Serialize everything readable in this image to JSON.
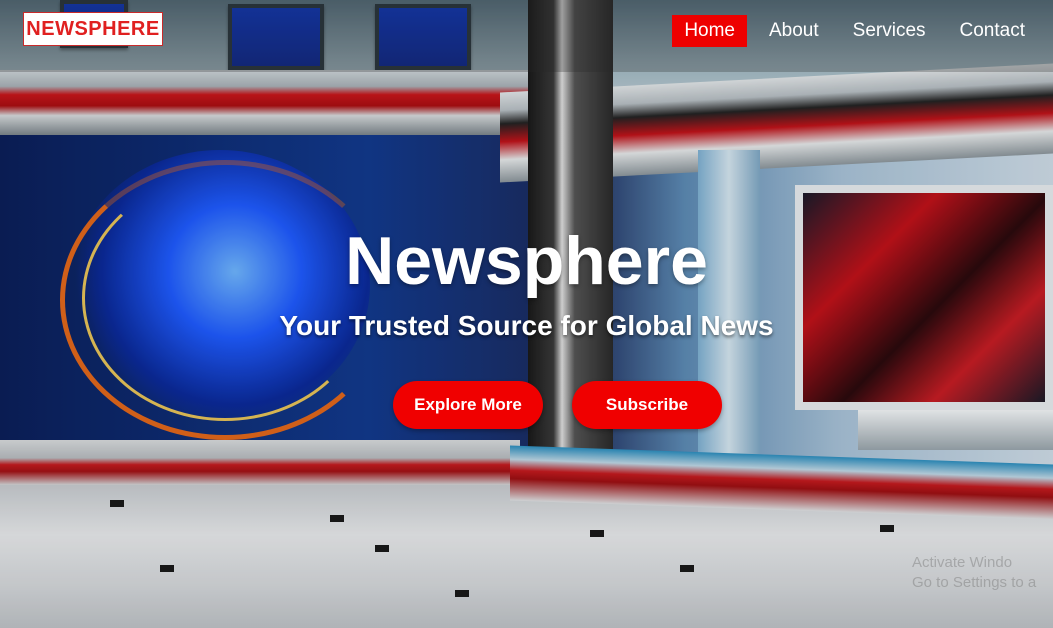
{
  "nav": {
    "logo_text": "NEWSPHERE",
    "links": [
      {
        "label": "Home",
        "active": true
      },
      {
        "label": "About",
        "active": false
      },
      {
        "label": "Services",
        "active": false
      },
      {
        "label": "Contact",
        "active": false
      }
    ]
  },
  "hero": {
    "title": "Newsphere",
    "subtitle": "Your Trusted Source for Global News",
    "buttons": {
      "explore_label": "Explore More",
      "subscribe_label": "Subscribe"
    }
  },
  "watermark": {
    "line1": "Activate Windo",
    "line2": "Go to Settings to a"
  },
  "colors": {
    "accent_red": "#f00000",
    "logo_red": "#e02020",
    "text_white": "#ffffff"
  }
}
